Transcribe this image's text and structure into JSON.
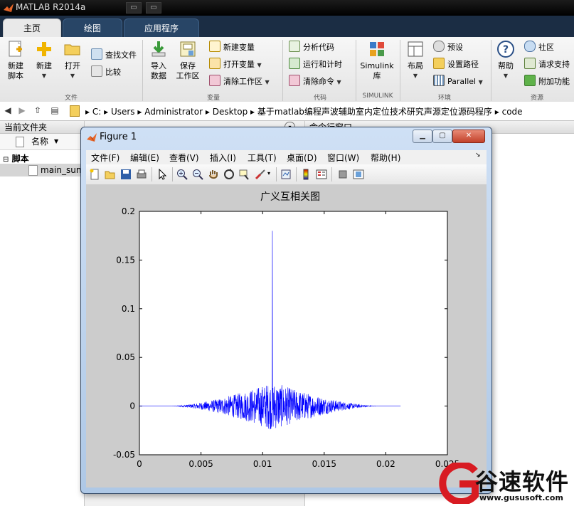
{
  "app": {
    "title": "MATLAB R2014a"
  },
  "ribbon": {
    "tabs": [
      "主页",
      "绘图",
      "应用程序"
    ],
    "file_group": {
      "label": "文件",
      "new_script": "新建\n脚本",
      "new": "新建",
      "open": "打开",
      "find_files": "查找文件",
      "compare": "比较"
    },
    "variable_group": {
      "label": "变量",
      "import_data": "导入\n数据",
      "save_workspace": "保存\n工作区",
      "new_variable": "新建变量",
      "open_variable": "打开变量",
      "clear_workspace": "清除工作区"
    },
    "code_group": {
      "label": "代码",
      "analyze_code": "分析代码",
      "run_and_time": "运行和计时",
      "clear_commands": "清除命令"
    },
    "simulink_group": {
      "label": "SIMULINK",
      "simulink_library": "Simulink\n库"
    },
    "environment_group": {
      "label": "环境",
      "layout": "布局",
      "preferences": "预设",
      "set_path": "设置路径",
      "parallel": "Parallel"
    },
    "resources_group": {
      "label": "资源",
      "help": "帮助",
      "community": "社区",
      "request_support": "请求支持",
      "add_ons": "附加功能"
    }
  },
  "address": {
    "segments": [
      "C:",
      "Users",
      "Administrator",
      "Desktop",
      "基于matlab编程声波辅助室内定位技术研究声源定位源码程序",
      "code"
    ]
  },
  "current_folder": {
    "title": "当前文件夹",
    "col_name": "名称",
    "group": "脚本",
    "file": "main_sun.m"
  },
  "command_window": {
    "title": "命令行窗口"
  },
  "figure": {
    "title": "Figure 1",
    "menus": [
      "文件(F)",
      "编辑(E)",
      "查看(V)",
      "插入(I)",
      "工具(T)",
      "桌面(D)",
      "窗口(W)",
      "帮助(H)"
    ]
  },
  "chart_data": {
    "type": "line",
    "title": "广义互相关图",
    "xlabel": "",
    "ylabel": "",
    "xlim": [
      0,
      0.025
    ],
    "ylim": [
      -0.05,
      0.2
    ],
    "xticks": [
      "0",
      "0.005",
      "0.01",
      "0.015",
      "0.02",
      "0.025"
    ],
    "yticks": [
      "-0.05",
      "0",
      "0.05",
      "0.1",
      "0.15",
      "0.2"
    ],
    "series": [
      {
        "color": "#0000ff",
        "x_range": [
          0,
          0.0212
        ],
        "peak": {
          "x": 0.0108,
          "y": 0.18
        },
        "noise_envelope": {
          "center": 0.0108,
          "max_amplitude": 0.025,
          "start": 0.0025,
          "end": 0.0195
        }
      }
    ],
    "grid": false
  },
  "watermark": {
    "text": "谷速软件",
    "url": "www.gususoft.com"
  },
  "colors": {
    "ribbon_tabs_bg": "#1b2d44",
    "figure_bg": "#cccccc",
    "plot_line": "#0000ff"
  }
}
